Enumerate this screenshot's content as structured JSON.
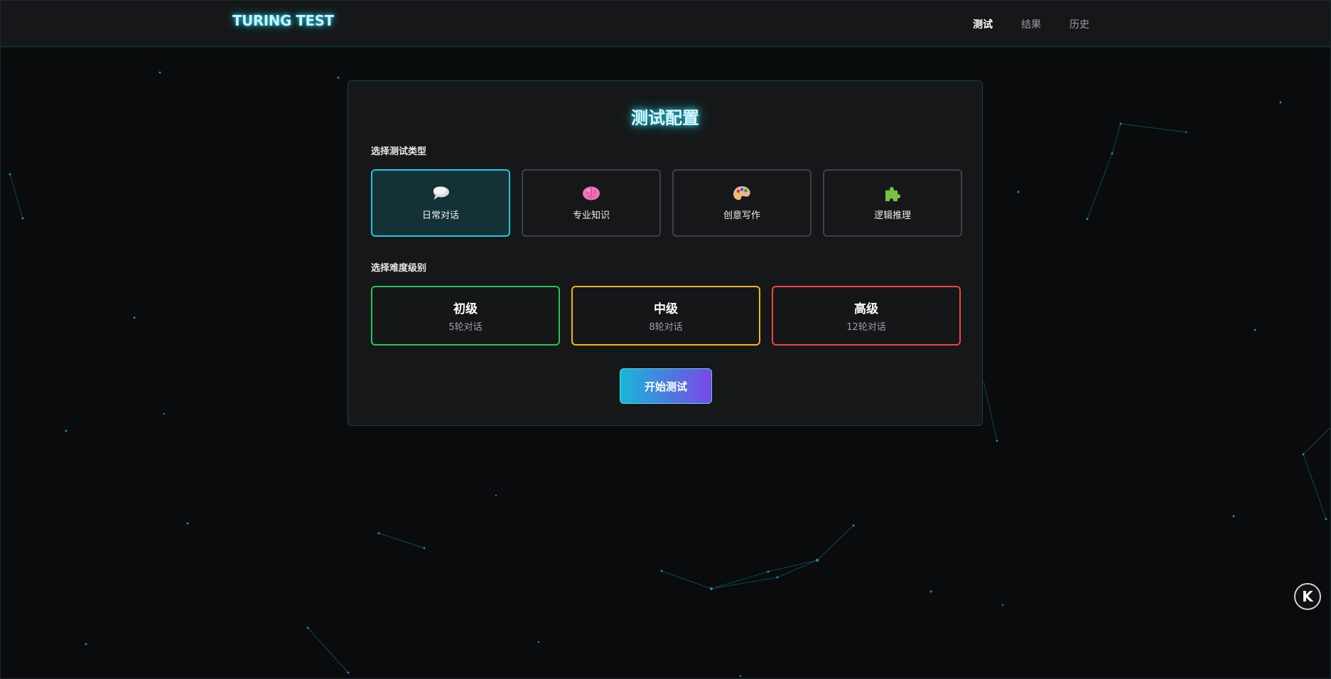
{
  "header": {
    "logo": "TURING TEST",
    "nav": [
      {
        "label": "测试",
        "active": true
      },
      {
        "label": "结果",
        "active": false
      },
      {
        "label": "历史",
        "active": false
      }
    ]
  },
  "config": {
    "title": "测试配置",
    "type_label": "选择测试类型",
    "types": [
      {
        "label": "日常对话",
        "icon": "speech-bubble-icon",
        "selected": true
      },
      {
        "label": "专业知识",
        "icon": "brain-icon",
        "selected": false
      },
      {
        "label": "创意写作",
        "icon": "palette-icon",
        "selected": false
      },
      {
        "label": "逻辑推理",
        "icon": "puzzle-icon",
        "selected": false
      }
    ],
    "difficulty_label": "选择难度级别",
    "difficulties": [
      {
        "name": "初级",
        "desc": "5轮对话",
        "color": "#22c55e"
      },
      {
        "name": "中级",
        "desc": "8轮对话",
        "color": "#f5b41a"
      },
      {
        "name": "高级",
        "desc": "12轮对话",
        "color": "#ef4444"
      }
    ],
    "start_label": "开始测试"
  },
  "badge": {
    "letter": "K",
    "icon": "k-logo-icon"
  },
  "colors": {
    "accent": "#22d3ee",
    "background": "#0a0b0c",
    "panel": "#161718",
    "gradient_start": "#17b7d8",
    "gradient_end": "#7a47e8"
  }
}
